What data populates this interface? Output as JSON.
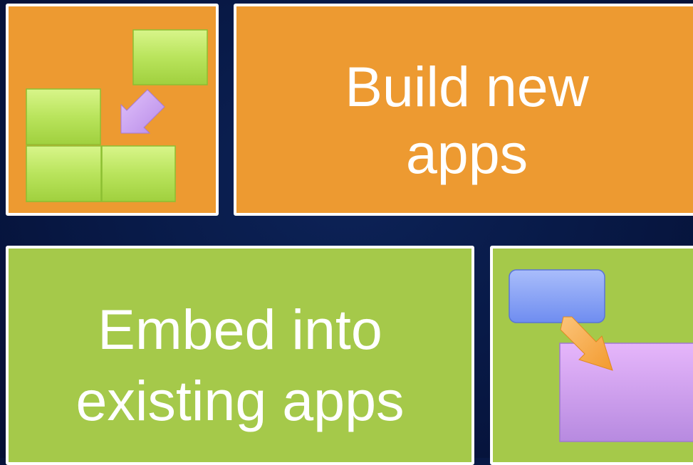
{
  "tiles": {
    "build_new_apps": {
      "label": "Build new\napps",
      "icon": "stacking-blocks-icon",
      "color": "#ED9A31"
    },
    "embed_existing": {
      "label": "Embed into\nexisting apps",
      "icon": "embed-window-icon",
      "color": "#A5C94A"
    }
  },
  "colors": {
    "background": "#081A48",
    "orange_tile": "#ED9A31",
    "green_tile": "#A5C94A",
    "block_green": "#B8E05A",
    "arrow_purple": "#C49AF0",
    "window_blue": "#7E9BF5",
    "window_purple": "#D9A8F5",
    "arrow_orange": "#F7A84A",
    "border": "#FFFFFF"
  }
}
